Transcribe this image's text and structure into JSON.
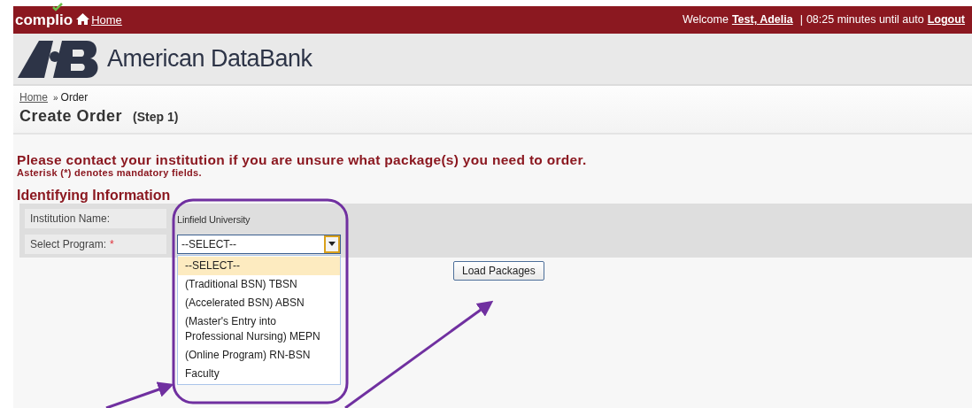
{
  "header": {
    "brand": "complio",
    "home_link": "Home",
    "welcome": "Welcome",
    "user": "Test, Adelia",
    "separator": "|",
    "timer": "08:25 minutes until auto",
    "logout": "Logout"
  },
  "logo": {
    "name": "American DataBank"
  },
  "breadcrumb": {
    "home": "Home",
    "separator": "»",
    "current": "Order"
  },
  "page_title": "Create Order",
  "step": "(Step 1)",
  "notice": "Please contact your institution if you are unsure what package(s) you need to order.",
  "mandatory_note": "Asterisk (*) denotes mandatory fields.",
  "section_title": "Identifying Information",
  "fields": [
    {
      "label": "Institution Name:",
      "kind": "text",
      "value": "Linfield University"
    },
    {
      "label": "Select Program:",
      "kind": "select",
      "required_mark": "*",
      "value": "--SELECT--",
      "expanded": true,
      "options": [
        {
          "label": "--SELECT--",
          "selected": true
        },
        {
          "label": "(Traditional BSN) TBSN",
          "selected": false
        },
        {
          "label": "(Accelerated BSN) ABSN",
          "selected": false
        },
        {
          "label": "(Master's Entry into Professional Nursing) MEPN",
          "selected": false
        },
        {
          "label": "(Online Program) RN-BSN",
          "selected": false
        },
        {
          "label": "Faculty",
          "selected": false
        }
      ]
    }
  ],
  "button": "Load Packages"
}
